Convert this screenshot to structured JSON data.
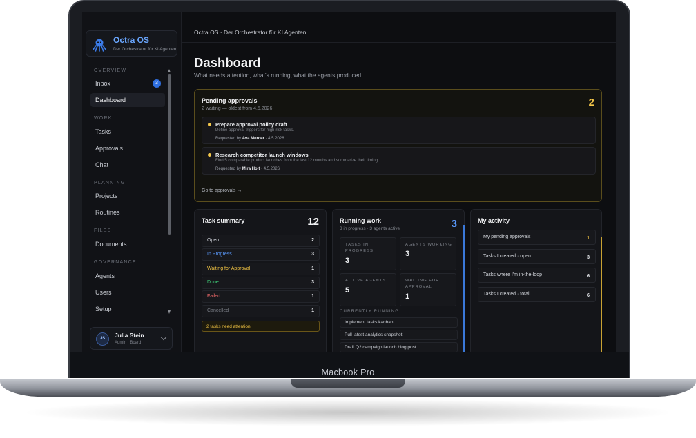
{
  "device_label": "Macbook Pro",
  "app": {
    "name": "Octra OS",
    "tagline": "Der Orchestrator für KI Agenten",
    "header_title": "Octra OS · Der Orchestrator für KI Agenten"
  },
  "sidebar": {
    "sections": [
      {
        "label": "OVERVIEW"
      },
      {
        "label": "WORK"
      },
      {
        "label": "PLANNING"
      },
      {
        "label": "FILES"
      },
      {
        "label": "GOVERNANCE"
      }
    ],
    "items": [
      {
        "label": "Inbox",
        "badge": "3",
        "icon": "inbox-icon"
      },
      {
        "label": "Dashboard",
        "active": true
      },
      {
        "label": "Tasks"
      },
      {
        "label": "Approvals"
      },
      {
        "label": "Chat"
      },
      {
        "label": "Projects"
      },
      {
        "label": "Routines"
      },
      {
        "label": "Documents"
      },
      {
        "label": "Agents"
      },
      {
        "label": "Users"
      },
      {
        "label": "Setup"
      }
    ],
    "user": {
      "initials": "JS",
      "name": "Julia Stein",
      "role": "Admin · Board"
    }
  },
  "page": {
    "title": "Dashboard",
    "subtitle": "What needs attention, what's running, what the agents produced."
  },
  "approvals": {
    "title": "Pending approvals",
    "subtitle": "2 waiting — oldest from 4.5.2026",
    "count": "2",
    "items": [
      {
        "title": "Prepare approval policy draft",
        "description": "Define approval triggers for high-risk tasks.",
        "requested_prefix": "Requested by",
        "requester": "Ava Mercer",
        "date": "· 4.5.2026"
      },
      {
        "title": "Research competitor launch windows",
        "description": "Find 5 comparable product launches from the last 12 months and summarize their timing.",
        "requested_prefix": "Requested by",
        "requester": "Mira Holt",
        "date": "· 4.5.2026"
      }
    ],
    "link": "Go to approvals →"
  },
  "task_summary": {
    "title": "Task summary",
    "count": "12",
    "rows": [
      {
        "label": "Open",
        "value": "2",
        "color": "#c9ccd3"
      },
      {
        "label": "In Progress",
        "value": "3",
        "color": "#5b9bff"
      },
      {
        "label": "Waiting for Approval",
        "value": "1",
        "color": "#f2c443"
      },
      {
        "label": "Done",
        "value": "3",
        "color": "#3fd17a"
      },
      {
        "label": "Failed",
        "value": "1",
        "color": "#f06a6a"
      },
      {
        "label": "Cancelled",
        "value": "1",
        "color": "#7b7f87"
      }
    ],
    "alert": "2 tasks need attention"
  },
  "running_work": {
    "title": "Running work",
    "subtitle": "3 in progress · 3 agents active",
    "count": "3",
    "stats": [
      {
        "label": "TASKS IN PROGRESS",
        "value": "3"
      },
      {
        "label": "AGENTS WORKING",
        "value": "3"
      },
      {
        "label": "ACTIVE AGENTS",
        "value": "5"
      },
      {
        "label": "WAITING FOR APPROVAL",
        "value": "1"
      }
    ],
    "section_label": "CURRENTLY RUNNING",
    "items": [
      {
        "label": "Implement tasks kanban"
      },
      {
        "label": "Pull latest analytics snapshot"
      },
      {
        "label": "Draft Q2 campaign launch blog post"
      }
    ]
  },
  "my_activity": {
    "title": "My activity",
    "rows": [
      {
        "label": "My pending approvals",
        "value": "1",
        "color": "#f2c443"
      },
      {
        "label": "Tasks I created · open",
        "value": "3",
        "color": "#e8eaee"
      },
      {
        "label": "Tasks where I'm in-the-loop",
        "value": "6",
        "color": "#e8eaee"
      },
      {
        "label": "Tasks I created · total",
        "value": "6",
        "color": "#e8eaee"
      }
    ]
  },
  "colors": {
    "accent_blue": "#5b9bff",
    "accent_yellow": "#f5c84a",
    "background": "#0d0e11"
  }
}
